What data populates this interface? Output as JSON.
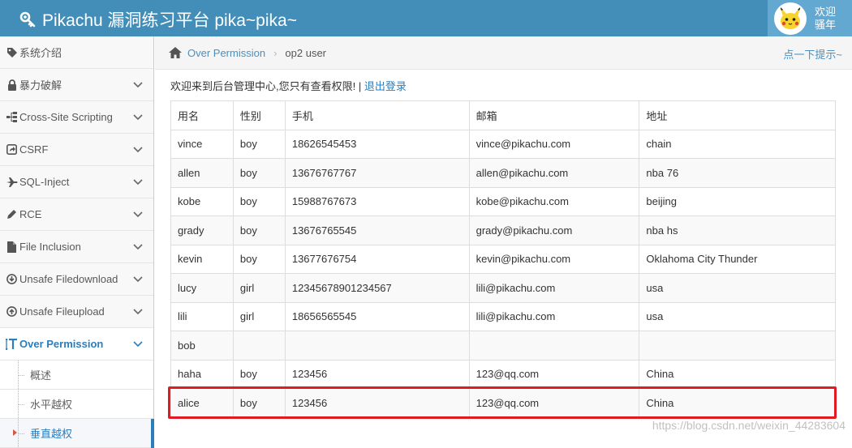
{
  "header": {
    "title": "Pikachu 漏洞练习平台 pika~pika~",
    "welcome_line1": "欢迎",
    "welcome_line2": "骚年",
    "accent_color": "#438eb9"
  },
  "sidebar": {
    "items": [
      {
        "label": "系统介绍",
        "icon": "tags-icon"
      },
      {
        "label": "暴力破解",
        "icon": "lock-icon"
      },
      {
        "label": "Cross-Site Scripting",
        "icon": "sitemap-icon"
      },
      {
        "label": "CSRF",
        "icon": "share-icon"
      },
      {
        "label": "SQL-Inject",
        "icon": "plane-icon"
      },
      {
        "label": "RCE",
        "icon": "pencil-icon"
      },
      {
        "label": "File Inclusion",
        "icon": "file-icon"
      },
      {
        "label": "Unsafe Filedownload",
        "icon": "download-icon"
      },
      {
        "label": "Unsafe Fileupload",
        "icon": "upload-icon"
      },
      {
        "label": "Over Permission",
        "icon": "text-height-icon"
      }
    ],
    "sub_items": [
      {
        "label": "概述"
      },
      {
        "label": "水平越权"
      },
      {
        "label": "垂直越权"
      }
    ]
  },
  "breadcrumbs": {
    "section": "Over Permission",
    "current": "op2 user",
    "hint": "点一下提示~"
  },
  "content": {
    "welcome": "欢迎来到后台管理中心,您只有查看权限! | ",
    "logout": "退出登录"
  },
  "table": {
    "headers": [
      "用名",
      "性别",
      "手机",
      "邮箱",
      "地址"
    ],
    "rows": [
      [
        "vince",
        "boy",
        "18626545453",
        "vince@pikachu.com",
        "chain"
      ],
      [
        "allen",
        "boy",
        "13676767767",
        "allen@pikachu.com",
        "nba 76"
      ],
      [
        "kobe",
        "boy",
        "15988767673",
        "kobe@pikachu.com",
        "beijing"
      ],
      [
        "grady",
        "boy",
        "13676765545",
        "grady@pikachu.com",
        "nba hs"
      ],
      [
        "kevin",
        "boy",
        "13677676754",
        "kevin@pikachu.com",
        "Oklahoma City Thunder"
      ],
      [
        "lucy",
        "girl",
        "12345678901234567",
        "lili@pikachu.com",
        "usa"
      ],
      [
        "lili",
        "girl",
        "18656565545",
        "lili@pikachu.com",
        "usa"
      ],
      [
        "bob",
        "",
        "",
        "",
        ""
      ],
      [
        "haha",
        "boy",
        "123456",
        "123@qq.com",
        "China"
      ],
      [
        "alice",
        "boy",
        "123456",
        "123@qq.com",
        "China"
      ]
    ],
    "highlight_color": "#e01b24"
  },
  "watermark": "https://blog.csdn.net/weixin_44283604"
}
